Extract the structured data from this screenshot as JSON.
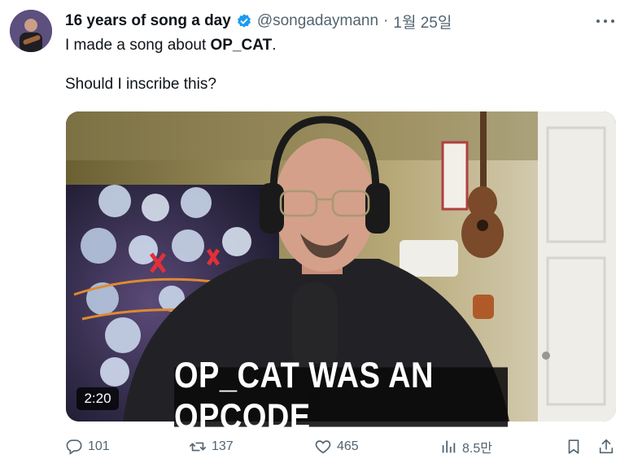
{
  "tweet": {
    "author_name": "16 years of song a day",
    "handle": "@songadaymann",
    "separator": "·",
    "date": "1월 25일",
    "text_line1_prefix": "I made a song about ",
    "text_line1_bold": "OP_CAT",
    "text_line1_suffix": ".",
    "text_line2": "Should I inscribe this?"
  },
  "media": {
    "caption": "OP_CAT WAS AN OPCODE",
    "duration": "2:20"
  },
  "actions": {
    "replies": "101",
    "retweets": "137",
    "likes": "465",
    "views": "8.5만"
  },
  "icons": {
    "verified": "verified-badge-icon",
    "more": "more-horizontal-icon",
    "reply": "reply-icon",
    "retweet": "retweet-icon",
    "like": "heart-icon",
    "views": "views-chart-icon",
    "bookmark": "bookmark-icon",
    "share": "share-icon"
  },
  "colors": {
    "accent": "#1d9bf0",
    "secondary_text": "#536471",
    "primary_text": "#0f1419"
  }
}
